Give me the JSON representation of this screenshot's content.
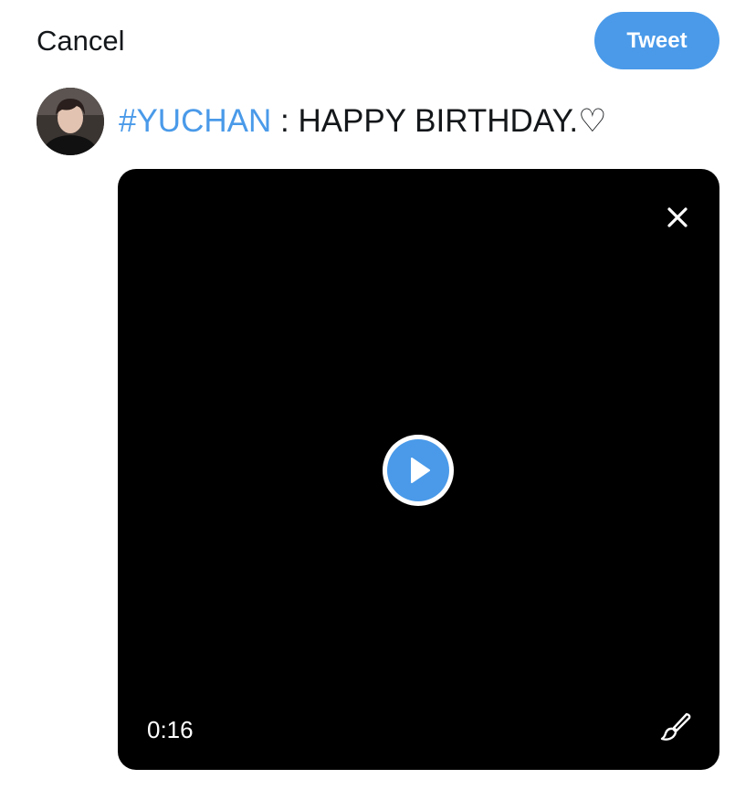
{
  "header": {
    "cancel_label": "Cancel",
    "tweet_label": "Tweet",
    "accent_color": "#4a9ae9"
  },
  "composer": {
    "hashtag": "#YUCHAN",
    "text": " : HAPPY BIRTHDAY.♡",
    "avatar_icon": "user-avatar"
  },
  "media": {
    "type": "video",
    "duration": "0:16",
    "icons": {
      "close": "close-icon",
      "play": "play-icon",
      "edit": "paintbrush-icon"
    }
  }
}
